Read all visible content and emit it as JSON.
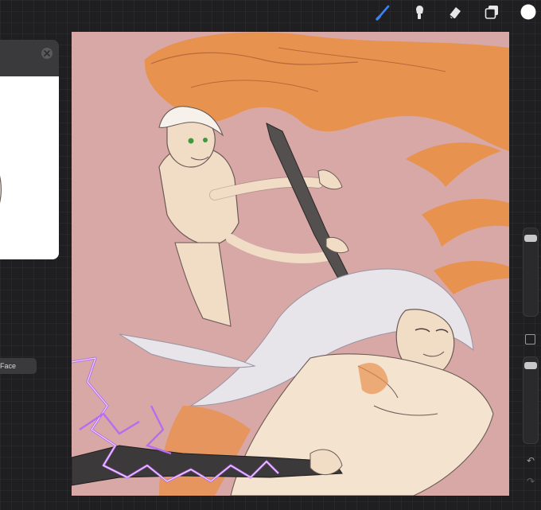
{
  "app": {
    "toolbar": {
      "icons": [
        "brush-icon",
        "smudge-icon",
        "eraser-icon",
        "layers-icon",
        "color-swatch"
      ],
      "active_color": "#ffffff",
      "active_tool_color": "#3b82f6"
    },
    "reference_panel": {
      "close_icon": "close-icon"
    },
    "face_button": {
      "label": "Face"
    },
    "sidebar": {
      "modify_icon": "square-icon",
      "undo_icon": "undo-icon",
      "redo_icon": "redo-icon"
    },
    "canvas": {
      "background": "#d7a8a5",
      "flame_color": "#e89250"
    }
  }
}
